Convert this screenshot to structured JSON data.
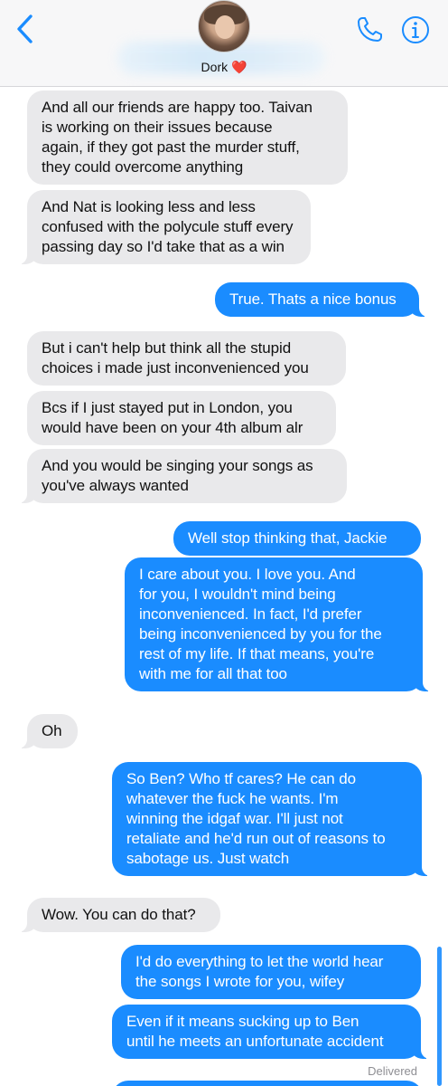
{
  "header": {
    "contact_name": "Dork",
    "contact_emoji": "❤️",
    "back_icon": "chevron-left-icon",
    "call_icon": "phone-icon",
    "info_icon": "info-icon",
    "accent_color": "#1a8cff"
  },
  "messages": [
    {
      "from": "them",
      "text": "And all our friends are happy too. Taivan\nis working on their issues because\nagain, if they got past the murder stuff,\nthey could overcome anything"
    },
    {
      "from": "them",
      "text": "And Nat is looking less and less\nconfused with the polycule stuff every\npassing day so I'd take that as a win"
    },
    {
      "from": "me",
      "text": "True. Thats a nice bonus"
    },
    {
      "from": "them",
      "text": "But i can't help but think all the stupid\nchoices i made just inconvenienced you"
    },
    {
      "from": "them",
      "text": "Bcs if I just stayed put in London, you\nwould have been on your 4th album alr"
    },
    {
      "from": "them",
      "text": "And you would be singing your songs as\nyou've always wanted"
    },
    {
      "from": "me",
      "text": "Well stop thinking that, Jackie"
    },
    {
      "from": "me",
      "text": "I care about you. I love you. And\nfor you, I wouldn't mind being\ninconvenienced. In fact, I'd prefer\nbeing inconvenienced by you for the\nrest of my life. If that means, you're\nwith me for all that too"
    },
    {
      "from": "them",
      "text": "Oh"
    },
    {
      "from": "me",
      "text": "So Ben? Who tf cares? He can do\nwhatever the fuck he wants. I'm\nwinning the idgaf war. I'll just not\nretaliate and he'd run out of reasons to\nsabotage us. Just watch"
    },
    {
      "from": "them",
      "text": "Wow. You can do that?"
    },
    {
      "from": "me",
      "text": "I'd do everything to let the world hear\nthe songs I wrote for you, wifey"
    },
    {
      "from": "me",
      "text": "Even if it means sucking up to Ben\nuntil he meets an unfortunate accident"
    }
  ],
  "status": {
    "delivered": "Delivered"
  }
}
